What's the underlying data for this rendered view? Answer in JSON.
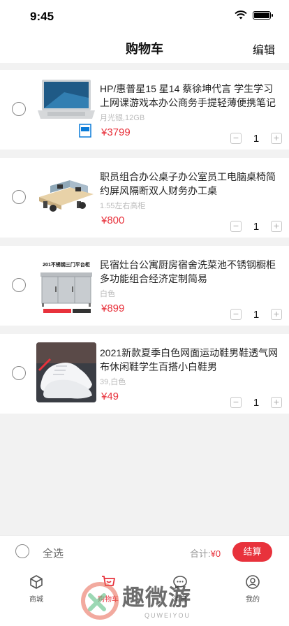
{
  "status_bar": {
    "time": "9:45"
  },
  "nav": {
    "title": "购物车",
    "edit_label": "编辑"
  },
  "cart": {
    "items": [
      {
        "title": "HP/惠普星15 星14 蔡徐坤代言 学生学习上网课游戏本办公商务手提轻薄便携笔记本…",
        "spec": "月光银,12GB",
        "price": "¥3799",
        "quantity": "1"
      },
      {
        "title": "职员组合办公桌子办公室员工电脑桌椅简约屏风隔断双人财务办工桌",
        "spec": "1.55左右高柜",
        "price": "¥800",
        "quantity": "1"
      },
      {
        "title": "民宿灶台公寓厨房宿舍洗菜池不锈钢橱柜多功能组合经济定制简易",
        "spec": "白色",
        "price": "¥899",
        "quantity": "1",
        "image_caption": "201不锈钢三门平台柜"
      },
      {
        "title": "2021新款夏季白色网面运动鞋男鞋透气网布休闲鞋学生百搭小白鞋男",
        "spec": "39,白色",
        "price": "¥49",
        "quantity": "1"
      }
    ]
  },
  "stepper": {
    "minus": "−",
    "plus": "+"
  },
  "footer": {
    "select_all": "全选",
    "total_label": "合计:",
    "total_value": "¥0",
    "checkout_label": "结算"
  },
  "tabs": [
    {
      "label": "商城",
      "icon": "cube-icon"
    },
    {
      "label": "购物车",
      "icon": "cart-icon",
      "active": true
    },
    {
      "label": "消息",
      "icon": "chat-icon"
    },
    {
      "label": "我的",
      "icon": "user-icon"
    }
  ],
  "watermark": {
    "text": "趣微游",
    "sub": "QUWEIYOU"
  },
  "colors": {
    "accent": "#e8323c",
    "background": "#f2f2f2"
  }
}
